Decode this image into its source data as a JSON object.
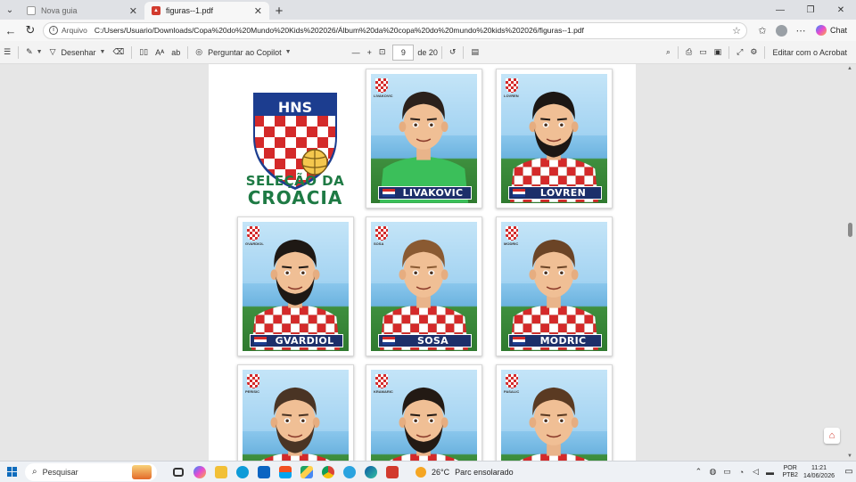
{
  "browser": {
    "tabs": [
      {
        "title": "Nova guia",
        "active": false
      },
      {
        "title": "figuras--1.pdf",
        "active": true
      }
    ],
    "address": {
      "scheme_label": "Arquivo",
      "url": "C:/Users/Usuario/Downloads/Copa%20do%20Mundo%20Kids%202026/Álbum%20da%20copa%20do%20mundo%20kids%202026/figuras--1.pdf"
    },
    "chat_label": "Chat"
  },
  "pdf_toolbar": {
    "draw_label": "Desenhar",
    "copilot_label": "Perguntar ao Copilot",
    "page_current": "9",
    "page_total": "de 20",
    "edit_label": "Editar com o Acrobat"
  },
  "page": {
    "logo_letters": "HNS",
    "logo_line1": "SELEÇÃO DA",
    "logo_line2": "CROACIA",
    "cards": [
      {
        "name": "LIVAKOVIC",
        "mini": "LIVAKOVIC",
        "kit": "goalkeeper",
        "hair": "#2b211c",
        "beard": false
      },
      {
        "name": "LOVREN",
        "mini": "LOVREN",
        "kit": "checker",
        "hair": "#1c1714",
        "beard": true
      },
      {
        "name": "GVARDIOL",
        "mini": "GVARDIOL",
        "kit": "checker",
        "hair": "#1e1814",
        "beard": true
      },
      {
        "name": "SOSA",
        "mini": "SOSA",
        "kit": "checker",
        "hair": "#8a5a32",
        "beard": false
      },
      {
        "name": "MODRIC",
        "mini": "MODRIC",
        "kit": "checker",
        "hair": "#6b4426",
        "beard": false
      },
      {
        "name": "",
        "mini": "PERISIC",
        "kit": "checker",
        "hair": "#4a3424",
        "beard": true
      },
      {
        "name": "",
        "mini": "KRAMARIC",
        "kit": "checker",
        "hair": "#231a14",
        "beard": true
      },
      {
        "name": "",
        "mini": "PASALIC",
        "kit": "checker",
        "hair": "#5a3a22",
        "beard": false
      }
    ]
  },
  "taskbar": {
    "search_placeholder": "Pesquisar",
    "weather_temp": "26°C",
    "weather_desc": "Parc ensolarado",
    "lang_1": "POR",
    "lang_2": "PTB2",
    "time": "11:21",
    "date": "14/06/2026"
  },
  "colors": {
    "croatia_red": "#d42a2a",
    "croatia_blue": "#1c2f6a",
    "logo_green": "#1e7a44",
    "gk_green": "#3bbf5a"
  }
}
